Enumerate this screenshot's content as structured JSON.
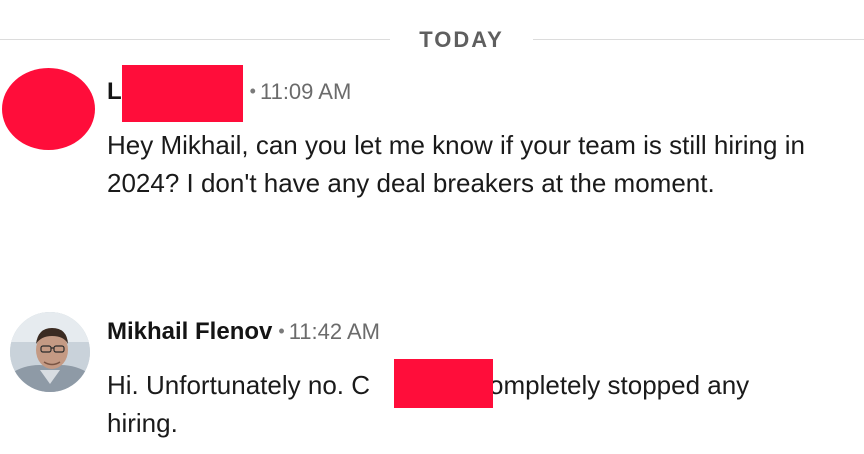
{
  "divider": {
    "label": "TODAY"
  },
  "messages": [
    {
      "sender": "L",
      "dot": "•",
      "time": "11:09 AM",
      "text": "Hey Mikhail, can you let me know if your team is still hiring in 2024? I don't have any deal breakers at the moment."
    },
    {
      "sender": "Mikhail Flenov",
      "dot": "•",
      "time": "11:42 AM",
      "text_before": "Hi. Unfortunately no. C",
      "text_after": "completely stopped any hiring."
    }
  ],
  "colors": {
    "redaction": "#ff0d3a",
    "divider_line": "#dcdcdc",
    "divider_text": "#5f5f5f",
    "time_text": "#6b6b6b"
  }
}
